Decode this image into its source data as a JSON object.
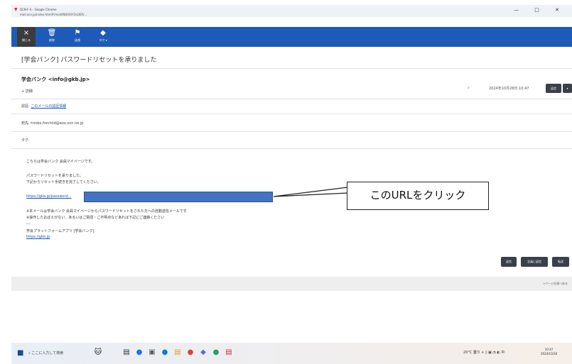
{
  "window": {
    "tab_title": "DCN-F-S - Google Chrome",
    "address": "mail.ocn.jp/index.html#/mail/INBOX/FOLDER/...",
    "controls": "— □ ✕"
  },
  "toolbar": {
    "buttons": [
      {
        "label": "閉じる",
        "icon": "×"
      },
      {
        "label": "削除",
        "icon": "🗑"
      },
      {
        "label": "迷惑",
        "icon": "⚑"
      },
      {
        "label": "タグ ▾",
        "icon": "◆"
      }
    ]
  },
  "email": {
    "subject": "[学会バンク] パスワードリセットを承りました",
    "sender": "学会バンク <info@gkb.jp>",
    "detail_toggle": "+ 詳細",
    "date": "2024年10月28日 10:47",
    "pin_icon": "clip-icon",
    "reply_button": "返信",
    "more_button": "▾",
    "spf_label": "認証:",
    "spf_link": "このメールの認証情報",
    "to_label": "宛先:",
    "to_value": "hiroko.forchild@aoo.ocn.ne.jp",
    "tag_label": "タグ:",
    "body": {
      "line1": "こちらは学会バンク 会員マイページです。",
      "line2": "パスワードリセットを承りました。",
      "line3": "下記からリセット手続きを完了してください。",
      "link": "https://gkb.jp/password...",
      "line4": "※本メールは学会バンク 会員マイページからパスワードリセットをされた方への自動送信メールです",
      "line5": "※操作したおぼえがない、あるいはご質問・ご不明点などあれば下記にご連絡ください",
      "sep": "---",
      "sig": "学会プラットフォームアプリ [学会バンク]",
      "sig_link": "https://gkb.jp"
    },
    "callout": "このURLをクリック",
    "bottom_buttons": [
      "返信",
      "全員に返信",
      "転送"
    ],
    "page_nav": "∧ページ先頭へ戻る"
  },
  "taskbar": {
    "start": "■",
    "search": "ここに入力して検索",
    "apps": [
      "🐱",
      "▤",
      "●",
      "▣",
      "●",
      "▤",
      "●",
      "◆",
      "●",
      "▤"
    ],
    "tray": "20°C 曇り  ∧ ▯ ▣ ◔ ◐ 中",
    "time": "10:47",
    "date": "2024/10/28"
  },
  "colors": {
    "toolbar": "#1e5bb8",
    "mask": "#4472c4",
    "link": "#1a57b5"
  }
}
